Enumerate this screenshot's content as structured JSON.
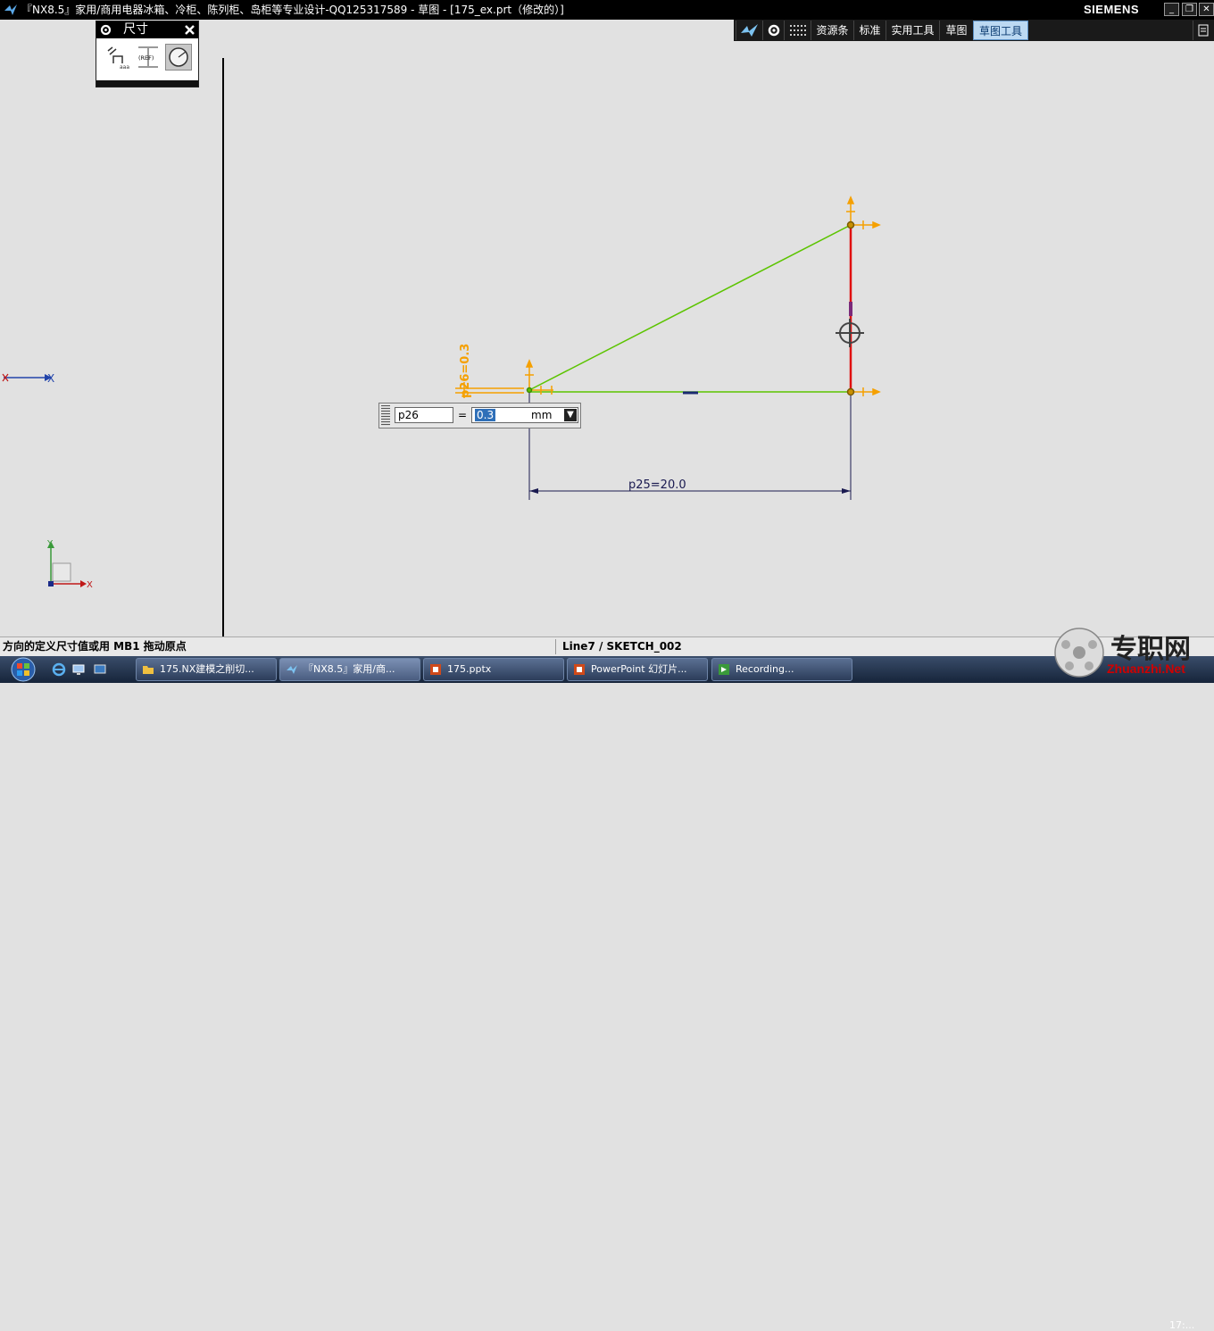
{
  "window": {
    "title": "『NX8.5』家用/商用电器冰箱、冷柜、陈列柜、岛柜等专业设计-QQ125317589 - 草图 - [175_ex.prt（修改的）]",
    "brand": "SIEMENS"
  },
  "ribbon": {
    "tabs": [
      "资源条",
      "标准",
      "实用工具",
      "草图",
      "草图工具"
    ],
    "active_tab": "草图工具"
  },
  "dimension_panel": {
    "title": "尺寸",
    "tool_ref_label": "(REF)"
  },
  "sketch": {
    "dimension_label": "p25=20.0",
    "vertical_dimension_label": "p26=0.3",
    "axis_x": "X",
    "axis_y": "Y"
  },
  "value_entry": {
    "name": "p26",
    "equals": "=",
    "value": "0.3",
    "unit": "mm"
  },
  "status": {
    "prompt": "方向的定义尺寸值或用 MB1 拖动原点",
    "selection": "Line7 / SKETCH_002"
  },
  "taskbar": {
    "items": [
      "175.NX建模之削切...",
      "『NX8.5』家用/商...",
      "175.pptx",
      "PowerPoint 幻灯片...",
      "Recording..."
    ],
    "clock": "17:..."
  },
  "watermark": {
    "cn": "专职网",
    "en": "Zhuanzhi.Net"
  },
  "colors": {
    "sketch_line": "#5cc400",
    "constrained_line": "#e01010",
    "constraint_symbol": "#f5a000",
    "dimension": "#1a1a50",
    "background": "#e1e1e1"
  }
}
